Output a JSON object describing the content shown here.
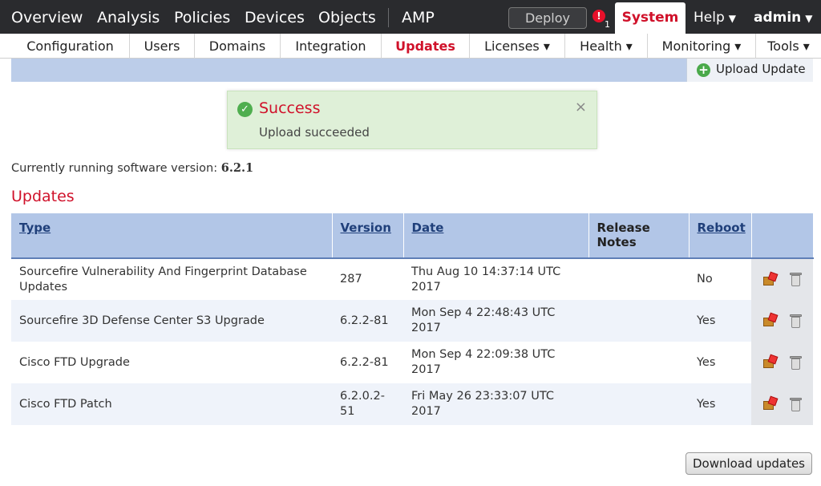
{
  "topnav": {
    "items": [
      "Overview",
      "Analysis",
      "Policies",
      "Devices",
      "Objects"
    ],
    "amp": "AMP",
    "deploy": "Deploy",
    "alert_count": "1",
    "system": "System",
    "help": "Help",
    "admin": "admin"
  },
  "subnav": {
    "items": [
      {
        "label": "Configuration"
      },
      {
        "label": "Users"
      },
      {
        "label": "Domains"
      },
      {
        "label": "Integration"
      },
      {
        "label": "Updates"
      },
      {
        "label": "Licenses ▾"
      },
      {
        "label": "Health ▾"
      },
      {
        "label": "Monitoring ▾"
      },
      {
        "label": "Tools ▾"
      }
    ]
  },
  "toolbar": {
    "upload_label": "Upload Update"
  },
  "message": {
    "title": "Success",
    "text": "Upload succeeded",
    "close": "×"
  },
  "version": {
    "label": "Currently running software version:",
    "value": "6.2.1"
  },
  "updates": {
    "heading": "Updates",
    "columns": [
      "Type",
      "Version",
      "Date",
      "Release Notes",
      "Reboot"
    ],
    "rows": [
      {
        "type": "Sourcefire Vulnerability And Fingerprint Database Updates",
        "version": "287",
        "date": "Thu Aug 10 14:37:14 UTC 2017",
        "notes": "",
        "reboot": "No"
      },
      {
        "type": "Sourcefire 3D Defense Center S3 Upgrade",
        "version": "6.2.2-81",
        "date": "Mon Sep 4 22:48:43 UTC 2017",
        "notes": "",
        "reboot": "Yes"
      },
      {
        "type": "Cisco FTD Upgrade",
        "version": "6.2.2-81",
        "date": "Mon Sep 4 22:09:38 UTC 2017",
        "notes": "",
        "reboot": "Yes"
      },
      {
        "type": "Cisco FTD Patch",
        "version": "6.2.0.2-51",
        "date": "Fri May 26 23:33:07 UTC 2017",
        "notes": "",
        "reboot": "Yes"
      }
    ]
  },
  "download_label": "Download updates",
  "colors": {
    "accent": "#d0112a",
    "nav_bg": "#2a2b2e",
    "header_blue": "#b2c6e7",
    "success_bg": "#dff0d8"
  }
}
